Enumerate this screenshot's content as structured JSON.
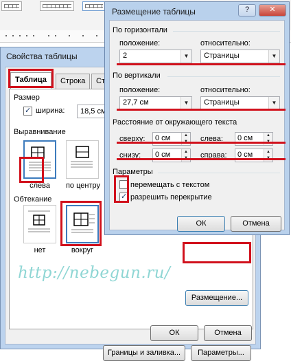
{
  "placement": {
    "title": "Размещение таблицы",
    "help_button": "?",
    "close_button": "✕",
    "horizontal_group": "По горизонтали",
    "h_position_label": "положение:",
    "h_position_value": "2",
    "h_relative_label": "относительно:",
    "h_relative_value": "Страницы",
    "vertical_group": "По вертикали",
    "v_position_label": "положение:",
    "v_position_value": "27,7 см",
    "v_relative_label": "относительно:",
    "v_relative_value": "Страницы",
    "distance_group": "Расстояние от окружающего текста",
    "top_label": "сверху:",
    "top_value": "0 см",
    "left_label": "слева:",
    "left_value": "0 см",
    "bottom_label": "снизу:",
    "bottom_value": "0 см",
    "right_label": "справа:",
    "right_value": "0 см",
    "options_group": "Параметры",
    "move_with_text": "перемещать с текстом",
    "move_with_text_checked": false,
    "allow_overlap": "разрешить перекрытие",
    "allow_overlap_checked": true,
    "ok": "ОК",
    "cancel": "Отмена"
  },
  "table_props": {
    "title": "Свойства таблицы",
    "close_button": "✕",
    "tabs": [
      "Таблица",
      "Строка",
      "Ст"
    ],
    "size_group": "Размер",
    "width_label": "ширина:",
    "width_checked": true,
    "width_value": "18,5 см",
    "alignment_group": "Выравнивание",
    "align_left": "слева",
    "align_center": "по центру",
    "wrap_group": "Обтекание",
    "wrap_none": "нет",
    "wrap_around": "вокруг",
    "placement_button": "Размещение...",
    "borders_button": "Границы и заливка...",
    "params_button": "Параметры...",
    "ok": "ОК",
    "cancel": "Отмена"
  },
  "watermark": "http://nebegun.ru/",
  "accent_color": "#d1111c"
}
